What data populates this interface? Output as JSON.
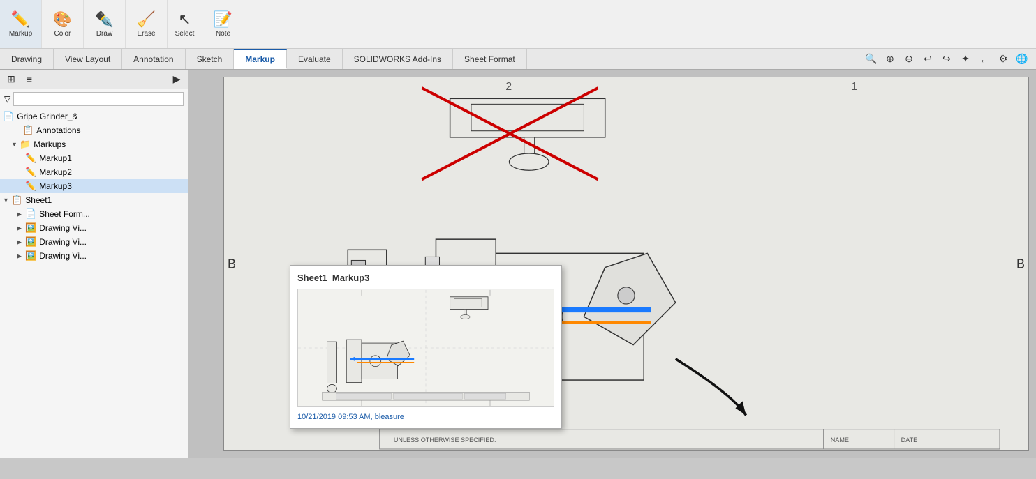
{
  "toolbar": {
    "groups": [
      {
        "id": "markup",
        "icon": "✏️",
        "label": "Markup"
      },
      {
        "id": "color",
        "icon": "🎨",
        "label": "Color"
      },
      {
        "id": "draw",
        "icon": "✒️",
        "label": "Draw"
      },
      {
        "id": "erase",
        "icon": "🧹",
        "label": "Erase"
      },
      {
        "id": "select",
        "icon": "↖",
        "label": "Select"
      },
      {
        "id": "note",
        "icon": "📝",
        "label": "Note"
      }
    ]
  },
  "tabs": [
    {
      "id": "drawing",
      "label": "Drawing"
    },
    {
      "id": "view-layout",
      "label": "View Layout"
    },
    {
      "id": "annotation",
      "label": "Annotation"
    },
    {
      "id": "sketch",
      "label": "Sketch"
    },
    {
      "id": "markup",
      "label": "Markup",
      "active": true
    },
    {
      "id": "evaluate",
      "label": "Evaluate"
    },
    {
      "id": "solidworks-addins",
      "label": "SOLIDWORKS Add-Ins"
    },
    {
      "id": "sheet-format",
      "label": "Sheet Format"
    }
  ],
  "sidebar": {
    "filter_placeholder": "",
    "tree": [
      {
        "id": "gripe",
        "label": "Gripe Grinder_&",
        "indent": 0,
        "icon": "📄",
        "hasArrow": false
      },
      {
        "id": "annotations",
        "label": "Annotations",
        "indent": 1,
        "icon": "📋",
        "hasArrow": false
      },
      {
        "id": "markups",
        "label": "Markups",
        "indent": 1,
        "icon": "📁",
        "hasArrow": true,
        "expanded": true
      },
      {
        "id": "markup1",
        "label": "Markup1",
        "indent": 2,
        "icon": "✏️",
        "hasArrow": false
      },
      {
        "id": "markup2",
        "label": "Markup2",
        "indent": 2,
        "icon": "✏️",
        "hasArrow": false
      },
      {
        "id": "markup3",
        "label": "Markup3",
        "indent": 2,
        "icon": "✏️",
        "hasArrow": false,
        "selected": true
      },
      {
        "id": "sheet1",
        "label": "Sheet1",
        "indent": 0,
        "icon": "📋",
        "hasArrow": true,
        "expanded": true
      },
      {
        "id": "sheetform",
        "label": "Sheet Form...",
        "indent": 1,
        "icon": "📄",
        "hasArrow": true
      },
      {
        "id": "drawingvi1",
        "label": "Drawing Vi...",
        "indent": 1,
        "icon": "🖼️",
        "hasArrow": true
      },
      {
        "id": "drawingvi2",
        "label": "Drawing Vi...",
        "indent": 1,
        "icon": "🖼️",
        "hasArrow": true
      },
      {
        "id": "drawingvi3",
        "label": "Drawing Vi...",
        "indent": 1,
        "icon": "🖼️",
        "hasArrow": true
      }
    ]
  },
  "markup_popup": {
    "title": "Sheet1_Markup3",
    "timestamp": "10/21/2019 09:53 AM, bleasure"
  },
  "sheet_labels": {
    "top_left_num": "2",
    "top_right_num": "1",
    "b_left": "B",
    "b_right": "B"
  },
  "toolbar2_icons": [
    "🔍",
    "🔎",
    "🔍",
    "↩",
    "↪",
    "✦",
    "←",
    "🔘"
  ],
  "footer": {
    "unless_specified": "UNLESS OTHERWISE SPECIFIED:",
    "name_col": "NAME",
    "date_col": "DATE"
  }
}
